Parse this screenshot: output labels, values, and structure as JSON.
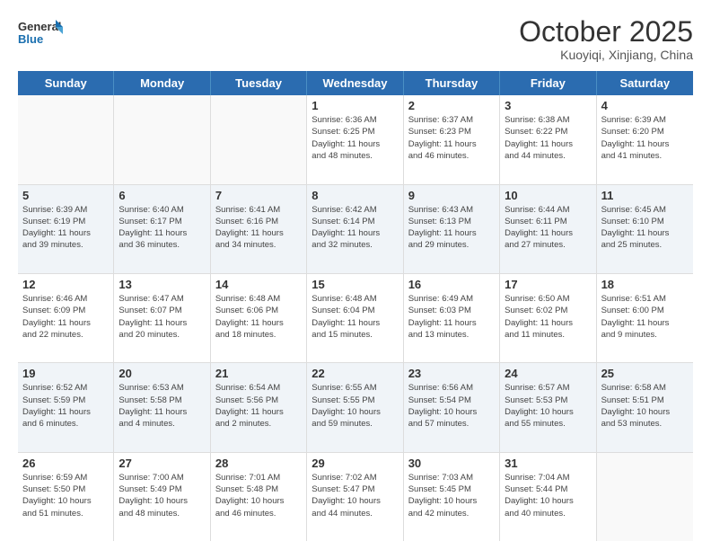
{
  "logo": {
    "line1": "General",
    "line2": "Blue"
  },
  "title": "October 2025",
  "subtitle": "Kuoyiqi, Xinjiang, China",
  "days_of_week": [
    "Sunday",
    "Monday",
    "Tuesday",
    "Wednesday",
    "Thursday",
    "Friday",
    "Saturday"
  ],
  "weeks": [
    [
      {
        "day": "",
        "info": ""
      },
      {
        "day": "",
        "info": ""
      },
      {
        "day": "",
        "info": ""
      },
      {
        "day": "1",
        "info": "Sunrise: 6:36 AM\nSunset: 6:25 PM\nDaylight: 11 hours\nand 48 minutes."
      },
      {
        "day": "2",
        "info": "Sunrise: 6:37 AM\nSunset: 6:23 PM\nDaylight: 11 hours\nand 46 minutes."
      },
      {
        "day": "3",
        "info": "Sunrise: 6:38 AM\nSunset: 6:22 PM\nDaylight: 11 hours\nand 44 minutes."
      },
      {
        "day": "4",
        "info": "Sunrise: 6:39 AM\nSunset: 6:20 PM\nDaylight: 11 hours\nand 41 minutes."
      }
    ],
    [
      {
        "day": "5",
        "info": "Sunrise: 6:39 AM\nSunset: 6:19 PM\nDaylight: 11 hours\nand 39 minutes."
      },
      {
        "day": "6",
        "info": "Sunrise: 6:40 AM\nSunset: 6:17 PM\nDaylight: 11 hours\nand 36 minutes."
      },
      {
        "day": "7",
        "info": "Sunrise: 6:41 AM\nSunset: 6:16 PM\nDaylight: 11 hours\nand 34 minutes."
      },
      {
        "day": "8",
        "info": "Sunrise: 6:42 AM\nSunset: 6:14 PM\nDaylight: 11 hours\nand 32 minutes."
      },
      {
        "day": "9",
        "info": "Sunrise: 6:43 AM\nSunset: 6:13 PM\nDaylight: 11 hours\nand 29 minutes."
      },
      {
        "day": "10",
        "info": "Sunrise: 6:44 AM\nSunset: 6:11 PM\nDaylight: 11 hours\nand 27 minutes."
      },
      {
        "day": "11",
        "info": "Sunrise: 6:45 AM\nSunset: 6:10 PM\nDaylight: 11 hours\nand 25 minutes."
      }
    ],
    [
      {
        "day": "12",
        "info": "Sunrise: 6:46 AM\nSunset: 6:09 PM\nDaylight: 11 hours\nand 22 minutes."
      },
      {
        "day": "13",
        "info": "Sunrise: 6:47 AM\nSunset: 6:07 PM\nDaylight: 11 hours\nand 20 minutes."
      },
      {
        "day": "14",
        "info": "Sunrise: 6:48 AM\nSunset: 6:06 PM\nDaylight: 11 hours\nand 18 minutes."
      },
      {
        "day": "15",
        "info": "Sunrise: 6:48 AM\nSunset: 6:04 PM\nDaylight: 11 hours\nand 15 minutes."
      },
      {
        "day": "16",
        "info": "Sunrise: 6:49 AM\nSunset: 6:03 PM\nDaylight: 11 hours\nand 13 minutes."
      },
      {
        "day": "17",
        "info": "Sunrise: 6:50 AM\nSunset: 6:02 PM\nDaylight: 11 hours\nand 11 minutes."
      },
      {
        "day": "18",
        "info": "Sunrise: 6:51 AM\nSunset: 6:00 PM\nDaylight: 11 hours\nand 9 minutes."
      }
    ],
    [
      {
        "day": "19",
        "info": "Sunrise: 6:52 AM\nSunset: 5:59 PM\nDaylight: 11 hours\nand 6 minutes."
      },
      {
        "day": "20",
        "info": "Sunrise: 6:53 AM\nSunset: 5:58 PM\nDaylight: 11 hours\nand 4 minutes."
      },
      {
        "day": "21",
        "info": "Sunrise: 6:54 AM\nSunset: 5:56 PM\nDaylight: 11 hours\nand 2 minutes."
      },
      {
        "day": "22",
        "info": "Sunrise: 6:55 AM\nSunset: 5:55 PM\nDaylight: 10 hours\nand 59 minutes."
      },
      {
        "day": "23",
        "info": "Sunrise: 6:56 AM\nSunset: 5:54 PM\nDaylight: 10 hours\nand 57 minutes."
      },
      {
        "day": "24",
        "info": "Sunrise: 6:57 AM\nSunset: 5:53 PM\nDaylight: 10 hours\nand 55 minutes."
      },
      {
        "day": "25",
        "info": "Sunrise: 6:58 AM\nSunset: 5:51 PM\nDaylight: 10 hours\nand 53 minutes."
      }
    ],
    [
      {
        "day": "26",
        "info": "Sunrise: 6:59 AM\nSunset: 5:50 PM\nDaylight: 10 hours\nand 51 minutes."
      },
      {
        "day": "27",
        "info": "Sunrise: 7:00 AM\nSunset: 5:49 PM\nDaylight: 10 hours\nand 48 minutes."
      },
      {
        "day": "28",
        "info": "Sunrise: 7:01 AM\nSunset: 5:48 PM\nDaylight: 10 hours\nand 46 minutes."
      },
      {
        "day": "29",
        "info": "Sunrise: 7:02 AM\nSunset: 5:47 PM\nDaylight: 10 hours\nand 44 minutes."
      },
      {
        "day": "30",
        "info": "Sunrise: 7:03 AM\nSunset: 5:45 PM\nDaylight: 10 hours\nand 42 minutes."
      },
      {
        "day": "31",
        "info": "Sunrise: 7:04 AM\nSunset: 5:44 PM\nDaylight: 10 hours\nand 40 minutes."
      },
      {
        "day": "",
        "info": ""
      }
    ]
  ]
}
